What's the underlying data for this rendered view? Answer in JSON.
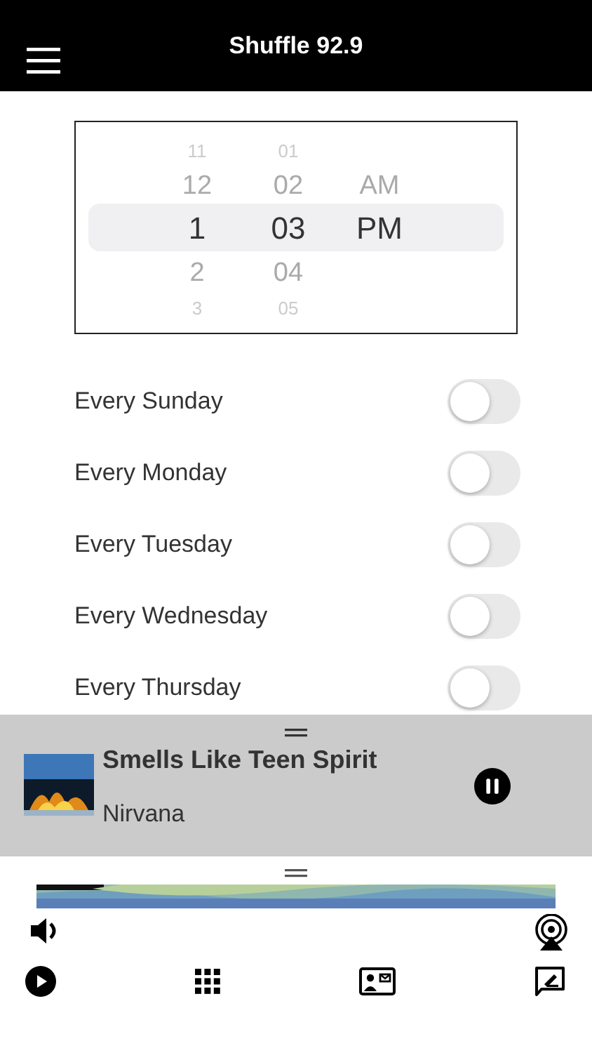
{
  "header": {
    "title": "Shuffle 92.9"
  },
  "time_picker": {
    "columns": [
      {
        "items": [
          {
            "text": "11",
            "selected": false
          },
          {
            "text": "12",
            "selected": false
          },
          {
            "text": "1",
            "selected": true
          },
          {
            "text": "2",
            "selected": false
          },
          {
            "text": "3",
            "selected": false
          }
        ]
      },
      {
        "items": [
          {
            "text": "01",
            "selected": false
          },
          {
            "text": "02",
            "selected": false
          },
          {
            "text": "03",
            "selected": true
          },
          {
            "text": "04",
            "selected": false
          },
          {
            "text": "05",
            "selected": false
          }
        ]
      },
      {
        "items": [
          {
            "text": "AM",
            "selected": false
          },
          {
            "text": "PM",
            "selected": true
          }
        ]
      }
    ]
  },
  "days": [
    {
      "label": "Every Sunday",
      "on": false
    },
    {
      "label": "Every Monday",
      "on": false
    },
    {
      "label": "Every Tuesday",
      "on": false
    },
    {
      "label": "Every Wednesday",
      "on": false
    },
    {
      "label": "Every Thursday",
      "on": false
    }
  ],
  "now_playing": {
    "title": "Smells Like Teen Spirit",
    "artist": "Nirvana",
    "playing": true
  }
}
